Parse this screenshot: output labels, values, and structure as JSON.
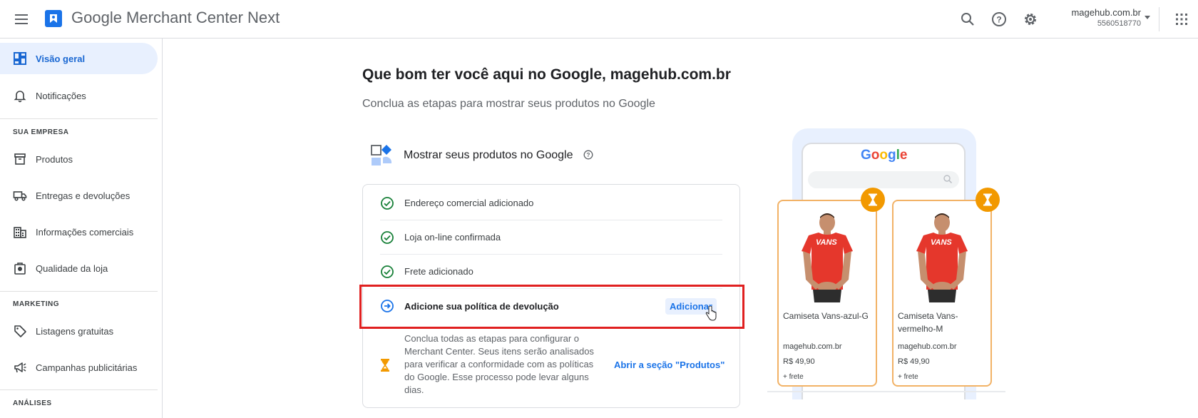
{
  "header": {
    "app_name": "Google Merchant Center Next",
    "account_name": "magehub.com.br",
    "account_id": "5560518770",
    "icons": [
      "menu-icon",
      "merchant-logo-icon",
      "search-icon",
      "help-icon",
      "settings-icon",
      "caret-down-icon",
      "apps-grid-icon"
    ]
  },
  "sidebar": {
    "items": [
      {
        "label": "Visão geral",
        "icon": "dashboard-icon",
        "active": true
      },
      {
        "label": "Notificações",
        "icon": "bell-icon"
      }
    ],
    "sections": [
      {
        "title": "SUA EMPRESA",
        "items": [
          {
            "label": "Produtos",
            "icon": "archive-box-icon"
          },
          {
            "label": "Entregas e devoluções",
            "icon": "truck-icon"
          },
          {
            "label": "Informações comerciais",
            "icon": "building-icon"
          },
          {
            "label": "Qualidade da loja",
            "icon": "store-badge-icon"
          }
        ]
      },
      {
        "title": "MARKETING",
        "items": [
          {
            "label": "Listagens gratuitas",
            "icon": "tag-icon"
          },
          {
            "label": "Campanhas publicitárias",
            "icon": "megaphone-icon"
          }
        ]
      },
      {
        "title": "ANÁLISES",
        "items": []
      }
    ]
  },
  "main": {
    "title": "Que bom ter você aqui no Google, magehub.com.br",
    "subtitle": "Conclua as etapas para mostrar seus produtos no Google",
    "card_title": "Mostrar seus produtos no Google",
    "steps": [
      {
        "label": "Endereço comercial adicionado",
        "status": "done"
      },
      {
        "label": "Loja on-line confirmada",
        "status": "done"
      },
      {
        "label": "Frete adicionado",
        "status": "done"
      },
      {
        "label": "Adicione sua política de devolução",
        "status": "pending",
        "action": "Adicionar"
      }
    ],
    "info_text": "Conclua todas as etapas para configurar o Merchant Center. Seus itens serão analisados para verificar a conformidade com as políticas do Google. Esse processo pode levar alguns dias.",
    "info_link": "Abrir a seção \"Produtos\""
  },
  "preview": {
    "search_brand": "Google",
    "products": [
      {
        "name": "Camiseta Vans-azul-G",
        "store": "magehub.com.br",
        "price": "R$ 49,90",
        "shipping": "+ frete",
        "shirt_text": "VANS"
      },
      {
        "name": "Camiseta Vans-vermelho-M",
        "store": "magehub.com.br",
        "price": "R$ 49,90",
        "shipping": "+ frete",
        "shirt_text": "VANS"
      }
    ]
  },
  "colors": {
    "accent_blue": "#1a73e8",
    "active_nav_bg": "#e8f0fe",
    "success_green": "#188038",
    "pending_orange": "#f29900",
    "highlight_red": "#e02020"
  }
}
